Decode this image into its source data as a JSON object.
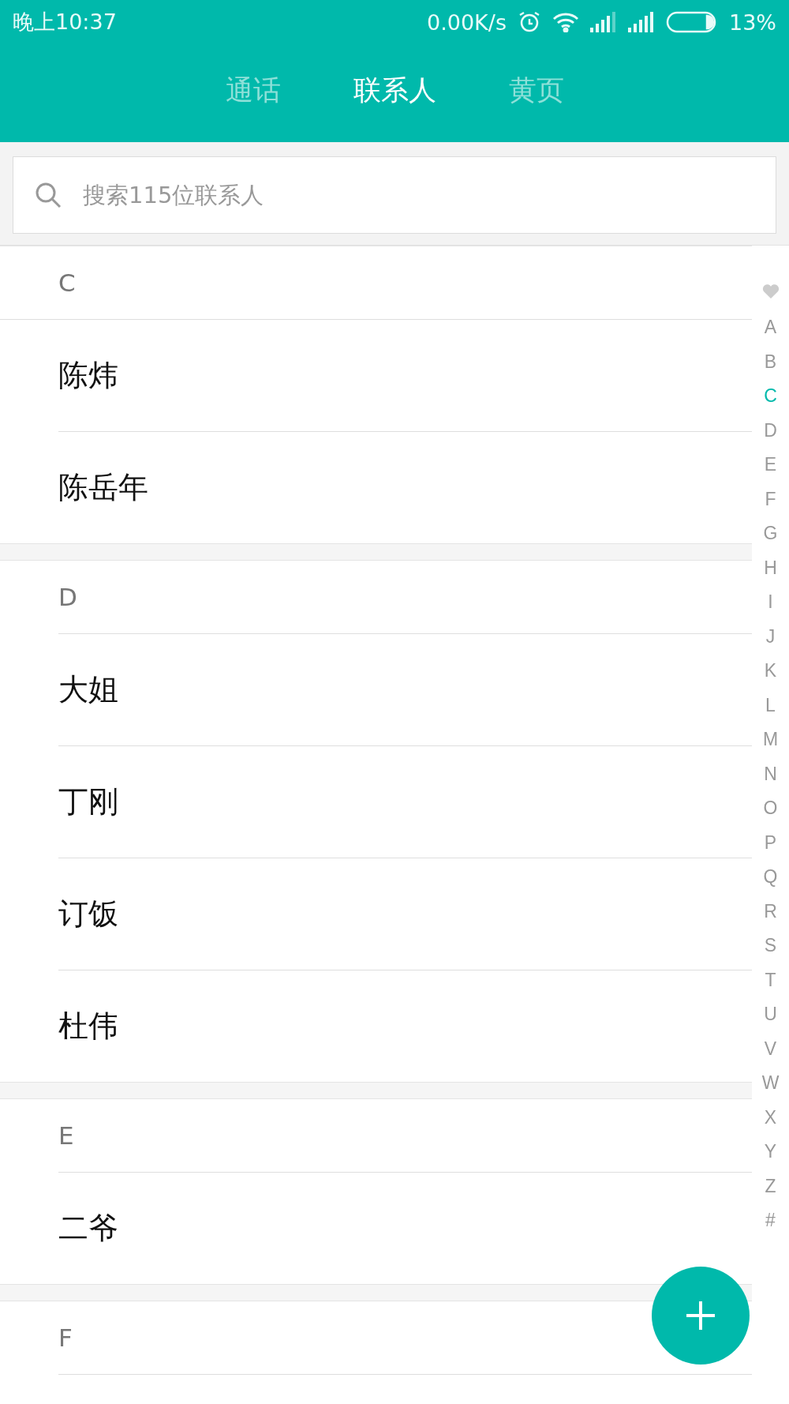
{
  "status_bar": {
    "time": "晚上10:37",
    "speed": "0.00K/s",
    "battery": "13%"
  },
  "tabs": [
    {
      "label": "通话",
      "selected": false
    },
    {
      "label": "联系人",
      "selected": true
    },
    {
      "label": "黄页",
      "selected": false
    }
  ],
  "search": {
    "placeholder": "搜索115位联系人"
  },
  "groups": [
    {
      "letter": "C",
      "contacts": [
        "陈炜",
        "陈岳年"
      ]
    },
    {
      "letter": "D",
      "contacts": [
        "大姐",
        "丁刚",
        "订饭",
        "杜伟"
      ]
    },
    {
      "letter": "E",
      "contacts": [
        "二爷"
      ]
    },
    {
      "letter": "F"
    }
  ],
  "index": [
    {
      "label": "A",
      "selected": false
    },
    {
      "label": "B",
      "selected": false
    },
    {
      "label": "C",
      "selected": true
    },
    {
      "label": "D",
      "selected": false
    },
    {
      "label": "E",
      "selected": false
    },
    {
      "label": "F",
      "selected": false
    },
    {
      "label": "G",
      "selected": false
    },
    {
      "label": "H",
      "selected": false
    },
    {
      "label": "I",
      "selected": false
    },
    {
      "label": "J",
      "selected": false
    },
    {
      "label": "K",
      "selected": false
    },
    {
      "label": "L",
      "selected": false
    },
    {
      "label": "M",
      "selected": false
    },
    {
      "label": "N",
      "selected": false
    },
    {
      "label": "O",
      "selected": false
    },
    {
      "label": "P",
      "selected": false
    },
    {
      "label": "Q",
      "selected": false
    },
    {
      "label": "R",
      "selected": false
    },
    {
      "label": "S",
      "selected": false
    },
    {
      "label": "T",
      "selected": false
    },
    {
      "label": "U",
      "selected": false
    },
    {
      "label": "V",
      "selected": false
    },
    {
      "label": "W",
      "selected": false
    },
    {
      "label": "X",
      "selected": false
    },
    {
      "label": "Y",
      "selected": false
    },
    {
      "label": "Z",
      "selected": false
    },
    {
      "label": "#",
      "selected": false
    }
  ]
}
